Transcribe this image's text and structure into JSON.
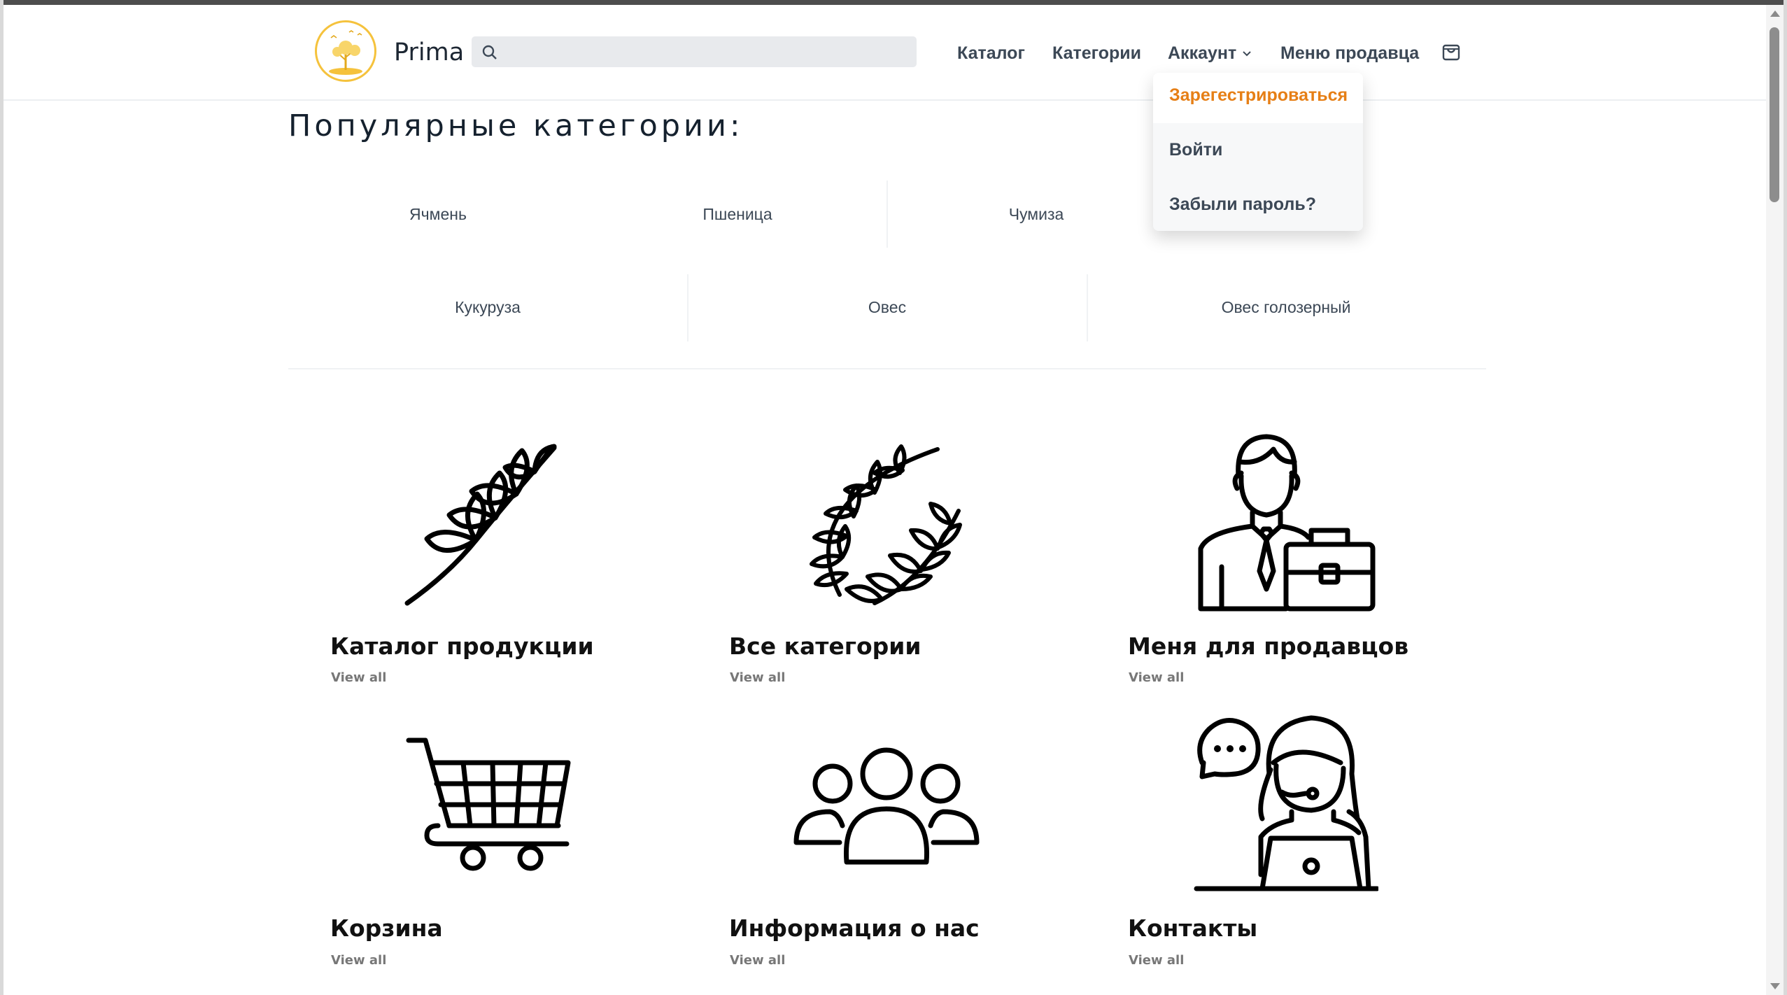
{
  "header": {
    "brand": "Prima",
    "search": {
      "placeholder": "",
      "value": ""
    },
    "nav": [
      {
        "label": "Каталог"
      },
      {
        "label": "Категории"
      },
      {
        "label": "Аккаунт"
      },
      {
        "label": "Меню продавца"
      }
    ]
  },
  "account_menu": {
    "items": [
      {
        "label": "Зарегестрироваться",
        "active": true
      },
      {
        "label": "Войти"
      },
      {
        "label": "Забыли пароль?"
      }
    ]
  },
  "popular": {
    "title": "Популярные категории:",
    "row1": [
      "Ячмень",
      "Пшеница",
      "Чумиза"
    ],
    "row2": [
      "Кукуруза",
      "Овес",
      "Овес голозерный"
    ]
  },
  "tiles": [
    {
      "title": "Каталог продукции",
      "link": "View all",
      "icon": "wheat-ear-icon"
    },
    {
      "title": "Все категории",
      "link": "View all",
      "icon": "laurel-wreath-icon"
    },
    {
      "title": "Меня для продавцов",
      "link": "View all",
      "icon": "businessman-icon"
    },
    {
      "title": "Корзина",
      "link": "View all",
      "icon": "shopping-cart-icon"
    },
    {
      "title": "Информация о нас",
      "link": "View all",
      "icon": "group-icon"
    },
    {
      "title": "Контакты",
      "link": "View all",
      "icon": "support-operator-icon"
    }
  ],
  "colors": {
    "accent": "#e67f16",
    "logo_ring": "#f5c23c",
    "nav_text": "#3c4856",
    "search_bg": "#e8eaed"
  }
}
